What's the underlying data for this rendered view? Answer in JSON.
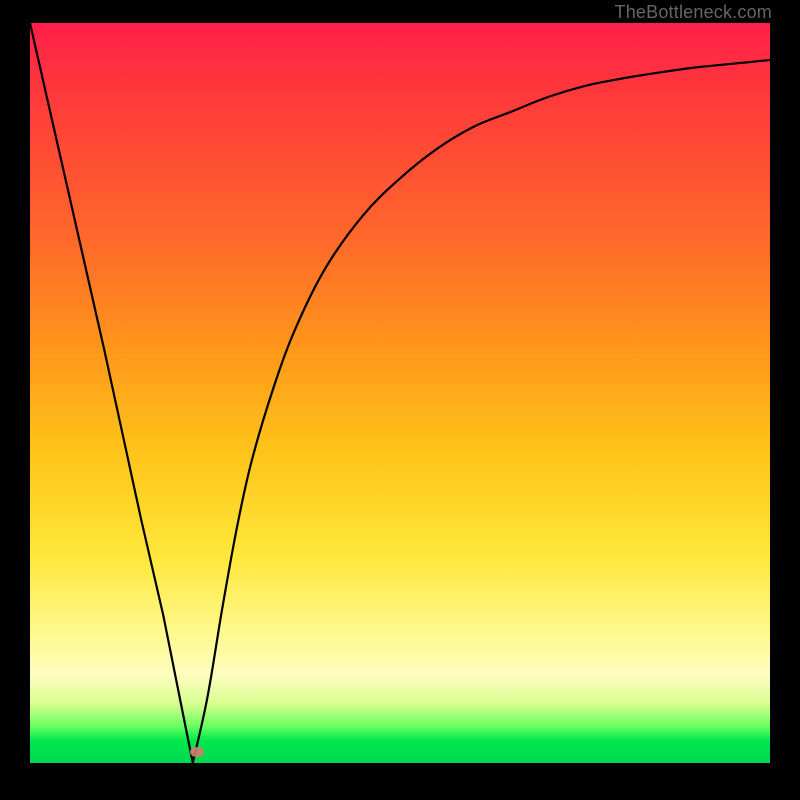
{
  "attribution": "TheBottleneck.com",
  "colors": {
    "frame": "#000000",
    "curve": "#000000",
    "marker": "#d77a6f",
    "gradient_stops": [
      "#ff1f4a",
      "#ff3a3a",
      "#ff6a2a",
      "#ff9a1a",
      "#ffc41a",
      "#ffe73a",
      "#fff88a",
      "#fffdc0",
      "#d8ff90",
      "#6aff60",
      "#00e84e",
      "#00d84e"
    ]
  },
  "chart_data": {
    "type": "line",
    "title": "",
    "xlabel": "",
    "ylabel": "",
    "xlim": [
      0,
      100
    ],
    "ylim": [
      0,
      100
    ],
    "notes": "Axes are unlabeled; x and y interpreted as 0–100% of plot area. Bottleneck-style curve: steep linear descent from top-left, minimum near x≈22, then saturating rise toward the right.",
    "minimum": {
      "x": 22,
      "y": 0
    },
    "series": [
      {
        "name": "bottleneck-curve",
        "x": [
          0,
          5,
          10,
          15,
          18,
          20,
          22,
          24,
          26,
          28,
          30,
          33,
          36,
          40,
          45,
          50,
          55,
          60,
          65,
          70,
          75,
          80,
          85,
          90,
          95,
          100
        ],
        "values": [
          100,
          78,
          56,
          33,
          20,
          10,
          0,
          9,
          21,
          32,
          41,
          51,
          59,
          67,
          74,
          79,
          83,
          86,
          88,
          90,
          91.5,
          92.5,
          93.3,
          94,
          94.5,
          95
        ]
      }
    ],
    "marker": {
      "x": 22.5,
      "y": 1.5
    }
  }
}
